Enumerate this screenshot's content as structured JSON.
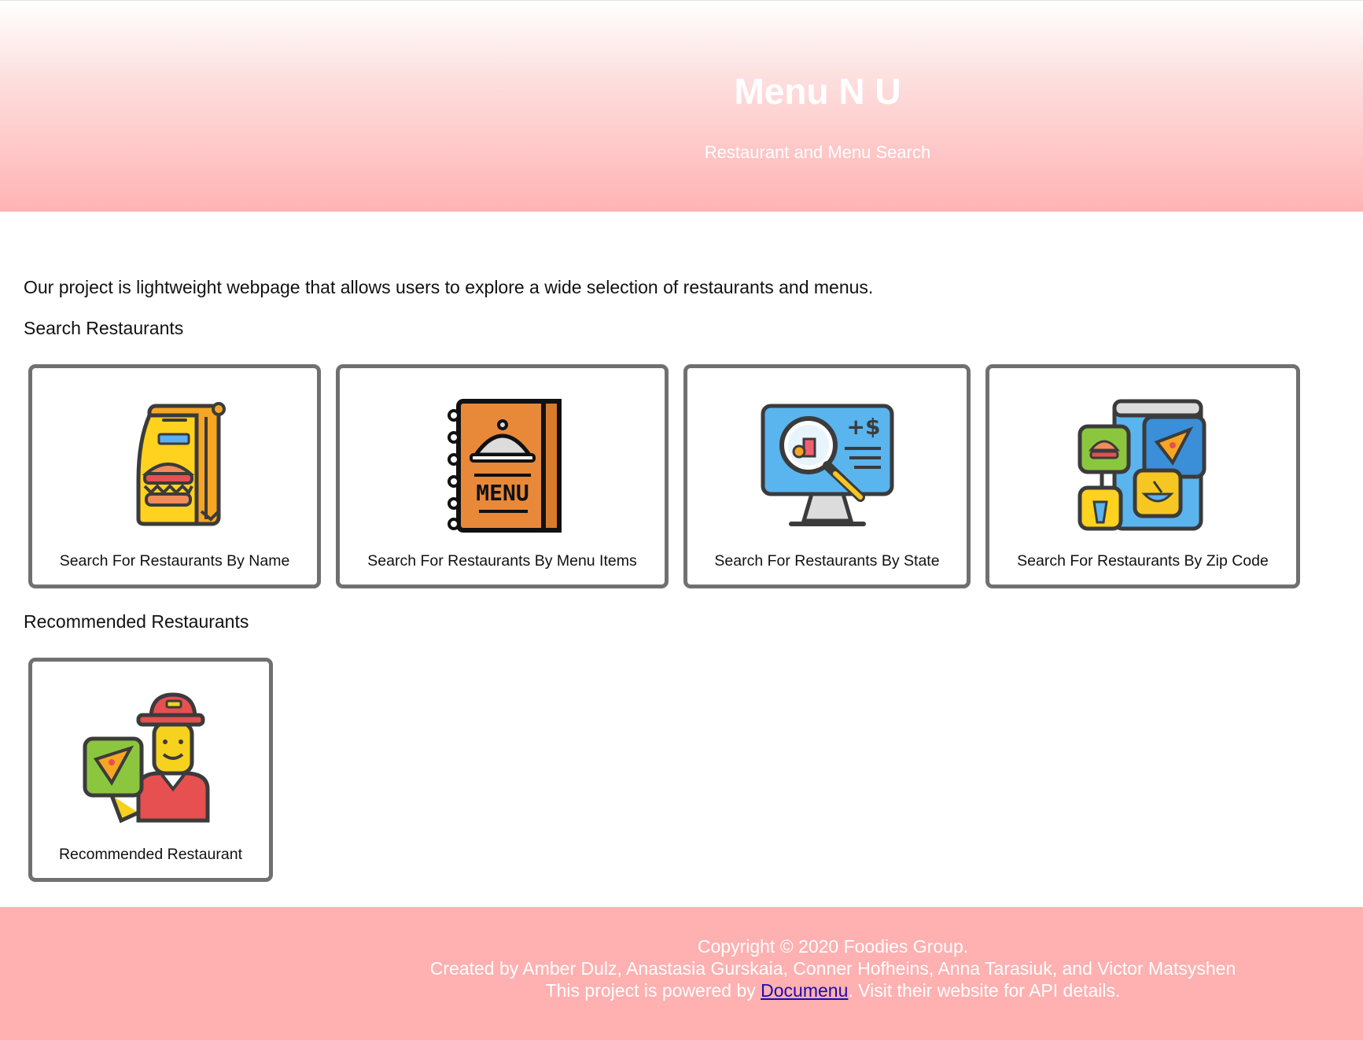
{
  "header": {
    "title": "Menu N U",
    "subtitle": "Restaurant and Menu Search"
  },
  "main": {
    "intro": "Our project is lightweight webpage that allows users to explore a wide selection of restaurants and menus.",
    "search_heading": "Search Restaurants",
    "search_cards": [
      {
        "label": "Search For Restaurants By Name",
        "icon": "takeout-bag-icon"
      },
      {
        "label": "Search For Restaurants By Menu Items",
        "icon": "menu-book-icon"
      },
      {
        "label": "Search For Restaurants By State",
        "icon": "monitor-search-icon"
      },
      {
        "label": "Search For Restaurants By Zip Code",
        "icon": "food-apps-icon"
      }
    ],
    "recommended_heading": "Recommended Restaurants",
    "recommended_cards": [
      {
        "label": "Recommended Restaurant",
        "icon": "delivery-person-icon"
      }
    ]
  },
  "footer": {
    "copyright": "Copyright © 2020 Foodies Group.",
    "credits": "Created by Amber Dulz, Anastasia Gurskaia, Conner Hofheins, Anna Tarasiuk, and Victor Matsyshen",
    "powered_prefix": "This project is powered by ",
    "powered_link": "Documenu",
    "powered_suffix": ". Visit their website for API details."
  },
  "colors": {
    "header_gradient_end": "#ffb3b3",
    "footer_bg": "#ffb0b0",
    "card_border": "#707070",
    "link": "#1a0dab"
  }
}
